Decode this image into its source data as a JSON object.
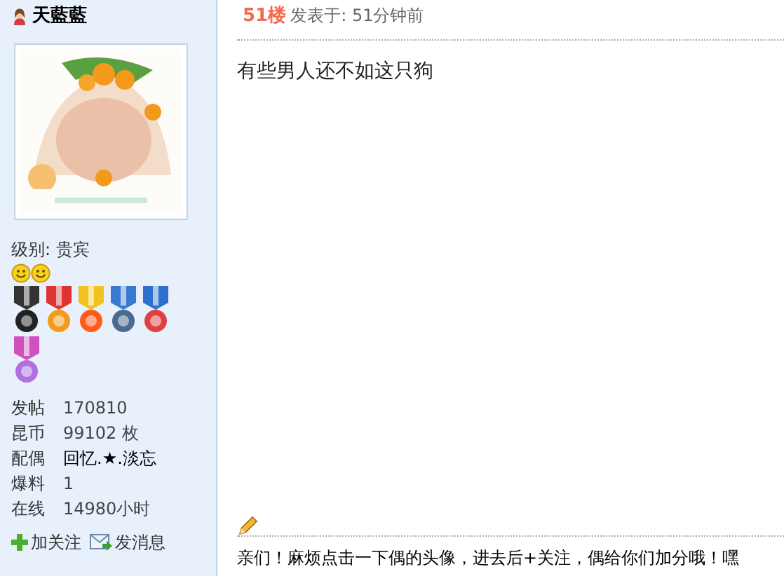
{
  "author": {
    "name": "天藍藍",
    "level_label": "级别: 贵宾",
    "rank_icons": [
      {
        "kind": "smiley"
      },
      {
        "kind": "smiley"
      }
    ],
    "stats": [
      {
        "label": "发帖",
        "value": "170810",
        "kind": "text"
      },
      {
        "label": "昆币",
        "value": "99102 枚",
        "kind": "text"
      },
      {
        "label": "配偶",
        "value": "回忆.★.淡忘",
        "kind": "link"
      },
      {
        "label": "爆料",
        "value": "1",
        "kind": "text"
      },
      {
        "label": "在线",
        "value": "14980小时",
        "kind": "text"
      }
    ],
    "actions": [
      {
        "label": "加关注",
        "kind": "follow"
      },
      {
        "label": "发消息",
        "kind": "message"
      }
    ]
  },
  "post": {
    "floor": "51楼",
    "posted": "发表于: 51分钟前",
    "body": "有些男人还不如这只狗",
    "signature": "亲们！麻烦点击一下偶的头像，进去后+关注，偶给你们加分哦！嘿"
  }
}
